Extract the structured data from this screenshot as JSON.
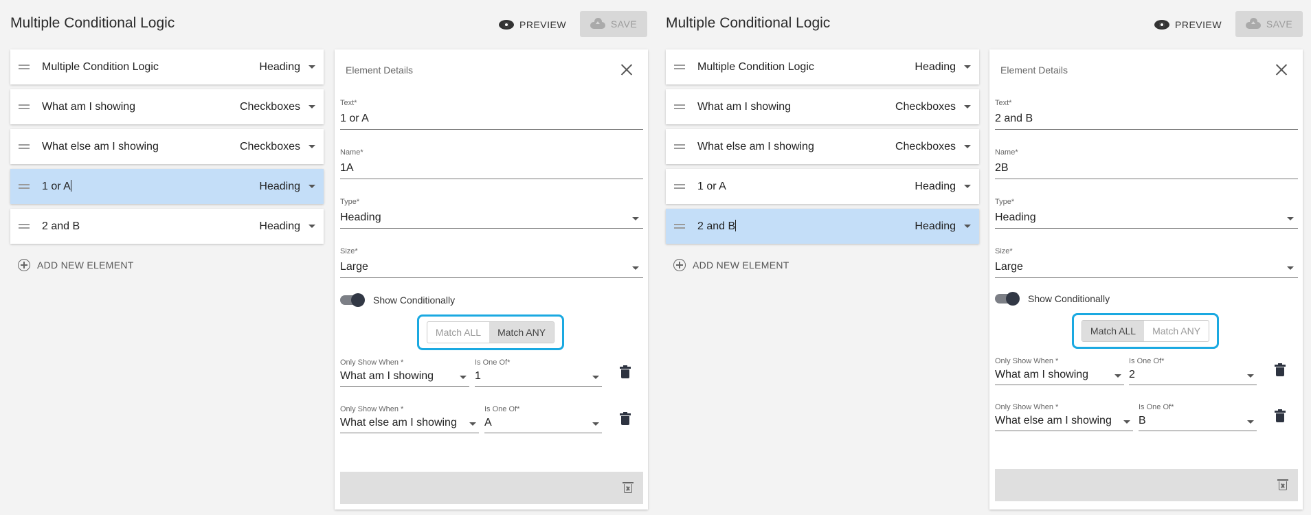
{
  "left": {
    "title": "Multiple Conditional Logic",
    "preview_label": "PREVIEW",
    "save_label": "SAVE",
    "elements": [
      {
        "label": "Multiple Condition Logic",
        "kind": "Heading"
      },
      {
        "label": "What am I showing",
        "kind": "Checkboxes"
      },
      {
        "label": "What else am I showing",
        "kind": "Checkboxes"
      },
      {
        "label": "1 or A",
        "kind": "Heading"
      },
      {
        "label": "2 and B",
        "kind": "Heading"
      }
    ],
    "selected_index": 3,
    "add_label": "ADD NEW ELEMENT",
    "details": {
      "title": "Element Details",
      "text_label": "Text*",
      "text_value": "1 or A",
      "name_label": "Name*",
      "name_value": "1A",
      "type_label": "Type*",
      "type_value": "Heading",
      "size_label": "Size*",
      "size_value": "Large",
      "show_cond_label": "Show Conditionally",
      "match_all": "Match ALL",
      "match_any": "Match ANY",
      "active_match": "any",
      "conditions": [
        {
          "when_label": "Only Show When *",
          "when_value": "What am I showing",
          "oneof_label": "Is One Of*",
          "oneof_value": "1"
        },
        {
          "when_label": "Only Show When *",
          "when_value": "What else am I showing",
          "oneof_label": "Is One Of*",
          "oneof_value": "A"
        }
      ]
    }
  },
  "right": {
    "title": "Multiple Conditional Logic",
    "preview_label": "PREVIEW",
    "save_label": "SAVE",
    "elements": [
      {
        "label": "Multiple Condition Logic",
        "kind": "Heading"
      },
      {
        "label": "What am I showing",
        "kind": "Checkboxes"
      },
      {
        "label": "What else am I showing",
        "kind": "Checkboxes"
      },
      {
        "label": "1 or A",
        "kind": "Heading"
      },
      {
        "label": "2 and B",
        "kind": "Heading"
      }
    ],
    "selected_index": 4,
    "add_label": "ADD NEW ELEMENT",
    "details": {
      "title": "Element Details",
      "text_label": "Text*",
      "text_value": "2 and B",
      "name_label": "Name*",
      "name_value": "2B",
      "type_label": "Type*",
      "type_value": "Heading",
      "size_label": "Size*",
      "size_value": "Large",
      "show_cond_label": "Show Conditionally",
      "match_all": "Match ALL",
      "match_any": "Match ANY",
      "active_match": "all",
      "conditions": [
        {
          "when_label": "Only Show When *",
          "when_value": "What am I showing",
          "oneof_label": "Is One Of*",
          "oneof_value": "2"
        },
        {
          "when_label": "Only Show When *",
          "when_value": "What else am I showing",
          "oneof_label": "Is One Of*",
          "oneof_value": "B"
        }
      ]
    }
  },
  "colors": {
    "selected_row": "#c4def8",
    "highlight_border": "#1aa9e1",
    "save_disabled_bg": "#d8d8d8"
  },
  "icons": [
    "eye-icon",
    "cloud-upload-icon",
    "drag-handle-icon",
    "chevron-down-icon",
    "add-circle-icon",
    "close-icon",
    "toggle-switch",
    "trash-icon",
    "trash-outline-icon"
  ]
}
